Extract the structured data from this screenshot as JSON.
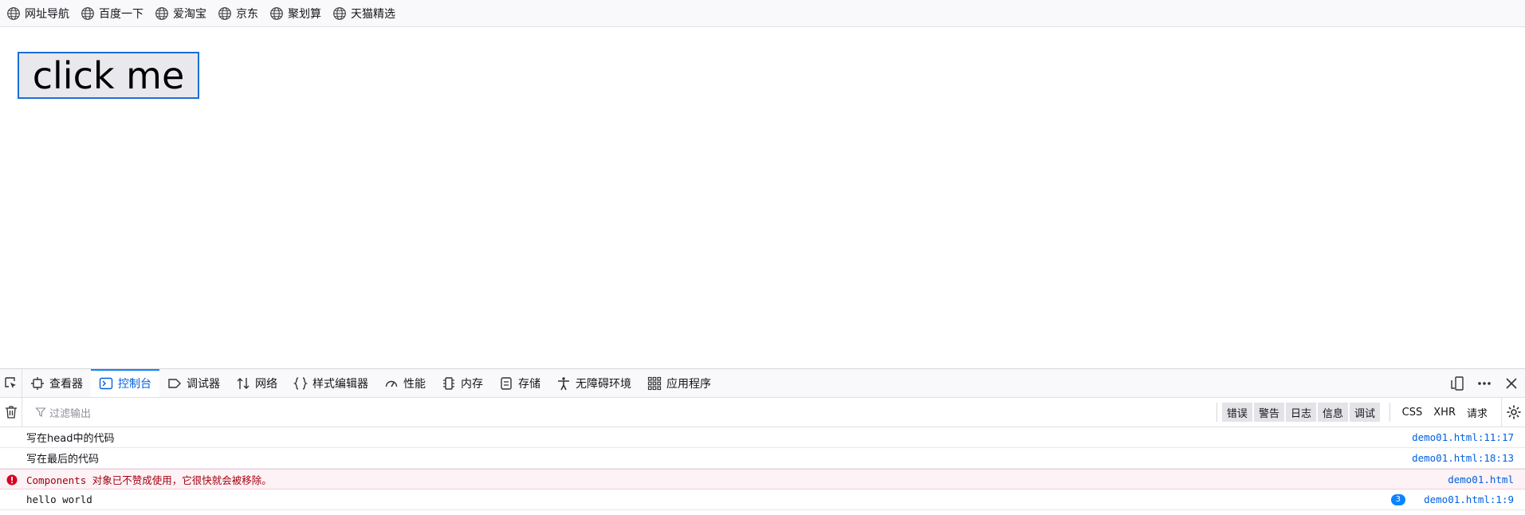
{
  "bookmarks": [
    {
      "label": "网址导航"
    },
    {
      "label": "百度一下"
    },
    {
      "label": "爱淘宝"
    },
    {
      "label": "京东"
    },
    {
      "label": "聚划算"
    },
    {
      "label": "天猫精选"
    }
  ],
  "page": {
    "button_label": "click me"
  },
  "devtools": {
    "tabs": [
      {
        "label": "查看器",
        "icon": "inspector-icon"
      },
      {
        "label": "控制台",
        "icon": "console-icon",
        "active": true
      },
      {
        "label": "调试器",
        "icon": "debugger-icon"
      },
      {
        "label": "网络",
        "icon": "network-icon"
      },
      {
        "label": "样式编辑器",
        "icon": "style-editor-icon"
      },
      {
        "label": "性能",
        "icon": "performance-icon"
      },
      {
        "label": "内存",
        "icon": "memory-icon"
      },
      {
        "label": "存储",
        "icon": "storage-icon"
      },
      {
        "label": "无障碍环境",
        "icon": "accessibility-icon"
      },
      {
        "label": "应用程序",
        "icon": "application-icon"
      }
    ],
    "filter_placeholder": "过滤输出",
    "levels": [
      "错误",
      "警告",
      "日志",
      "信息",
      "调试"
    ],
    "requests": [
      "CSS",
      "XHR",
      "请求"
    ],
    "messages": [
      {
        "text": "写在head中的代码",
        "location": "demo01.html:11:17"
      },
      {
        "text": "写在最后的代码",
        "location": "demo01.html:18:13"
      },
      {
        "text": "Components 对象已不赞成使用，它很快就会被移除。",
        "location": "demo01.html",
        "level": "error"
      },
      {
        "text": "hello world",
        "location": "demo01.html:1:9",
        "repeat": "3"
      }
    ]
  },
  "colors": {
    "accent": "#0060df",
    "error_bg": "#fdf2f5",
    "error_text": "#a4000f",
    "button_border": "#1a6fd6"
  }
}
